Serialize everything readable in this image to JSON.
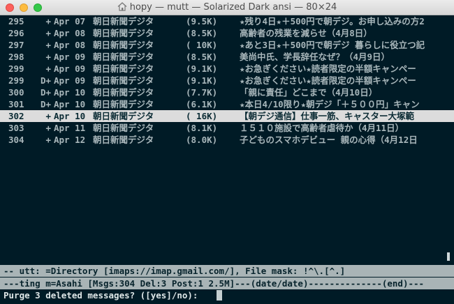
{
  "window": {
    "title": "hopy — mutt — Solarized Dark ansi — 80×24"
  },
  "messages": [
    {
      "num": "295",
      "flag": "+",
      "date": "Apr 07",
      "from": "朝日新聞デジタ",
      "size": "(9.5K)",
      "subject": "★残り4日★＋500円で朝デジ。お申し込みの方2"
    },
    {
      "num": "296",
      "flag": "+",
      "date": "Apr 08",
      "from": "朝日新聞デジタ",
      "size": "(8.5K)",
      "subject": "高齢者の残業を減らせ（4月8日）"
    },
    {
      "num": "297",
      "flag": "+",
      "date": "Apr 08",
      "from": "朝日新聞デジタ",
      "size": "( 10K)",
      "subject": "★あと3日★＋500円で朝デジ 暮らしに役立つ記"
    },
    {
      "num": "298",
      "flag": "+",
      "date": "Apr 09",
      "from": "朝日新聞デジタ",
      "size": "(8.5K)",
      "subject": "美尚中氏、学長辞任なぜ？（4月9日）"
    },
    {
      "num": "299",
      "flag": "+",
      "date": "Apr 09",
      "from": "朝日新聞デジタ",
      "size": "(9.1K)",
      "subject": "★お急ぎください★読者限定の半額キャンペー"
    },
    {
      "num": "299",
      "flag": "D+",
      "date": "Apr 09",
      "from": "朝日新聞デジタ",
      "size": "(9.1K)",
      "subject": "★お急ぎください★読者限定の半額キャンペー"
    },
    {
      "num": "300",
      "flag": "D+",
      "date": "Apr 10",
      "from": "朝日新聞デジタ",
      "size": "(7.7K)",
      "subject": "「親に責任」どこまで（4月10日）"
    },
    {
      "num": "301",
      "flag": "D+",
      "date": "Apr 10",
      "from": "朝日新聞デジタ",
      "size": "(6.1K)",
      "subject": "★本日4/10限り★朝デジ「＋５００円」キャン"
    },
    {
      "num": "302",
      "flag": "+",
      "date": "Apr 10",
      "from": "朝日新聞デジタ",
      "size": "( 16K)",
      "subject": "【朝デジ通信】仕事一筋、キャスター大塚範"
    },
    {
      "num": "303",
      "flag": "+",
      "date": "Apr 11",
      "from": "朝日新聞デジタ",
      "size": "(8.1K)",
      "subject": "１５１０施設で高齢者虐待か（4月11日）"
    },
    {
      "num": "304",
      "flag": "+",
      "date": "Apr 12",
      "from": "朝日新聞デジタ",
      "size": "(8.0K)",
      "subject": "子どものスマホデビュー 親の心得（4月12日"
    }
  ],
  "selected_index": 8,
  "status": {
    "directory_line": "-- utt: =Directory [imaps://imap.gmail.com/], File mask: !^\\.[^.]",
    "index_line": "---ting m=Asahi [Msgs:304 Del:3 Post:1 2.5M]---(date/date)--------------(end)---"
  },
  "prompt": {
    "text": "Purge 3 deleted messages? ([yes]/no): "
  },
  "colors": {
    "background": "#001b26",
    "foreground": "#a9b7bb",
    "selection": "#dcdcdc",
    "status_bar": "#a9b4b6"
  }
}
